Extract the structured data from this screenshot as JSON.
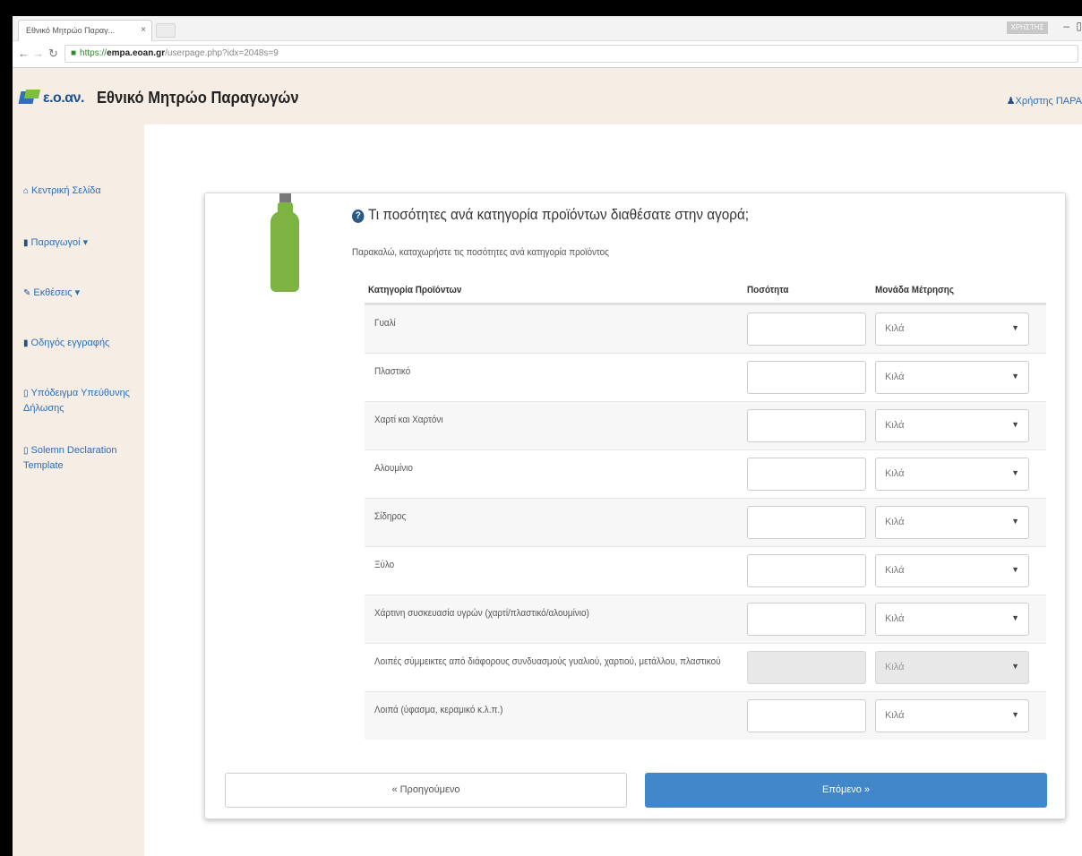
{
  "browser": {
    "tab_title": "Εθνικό Μητρώο Παραγ...",
    "tab_close": "×",
    "url_scheme": "https://",
    "url_host": "empa.eoan.gr",
    "url_path": "/userpage.php?idx=2048s=9",
    "window_user": "ΧΡΗΣΤΗΣ",
    "minimize": "–"
  },
  "header": {
    "logo_text": "ε.ο.αν.",
    "title": "Εθνικό Μητρώο Παραγωγών",
    "user_link": "Χρήστης ΠΑΡΑ"
  },
  "sidebar": {
    "items": [
      {
        "icon": "home-icon",
        "label": "Κεντρική Σελίδα"
      },
      {
        "icon": "book-icon",
        "label": "Παραγωγοί ▾"
      },
      {
        "icon": "pencil-icon",
        "label": "Εκθέσεις ▾"
      },
      {
        "icon": "book-icon",
        "label": "Οδηγός εγγραφής"
      },
      {
        "icon": "document-icon",
        "label": "Υπόδειγμα Υπεύθυνης Δήλωσης"
      },
      {
        "icon": "document-icon",
        "label": "Solemn Declaration Template"
      }
    ]
  },
  "form": {
    "question": "Τι ποσότητες ανά κατηγορία προϊόντων διαθέσατε στην αγορά;",
    "instruction": "Παρακαλώ, καταχωρήστε τις ποσότητες ανά κατηγορία προϊόντος",
    "columns": {
      "category": "Κατηγορία Προϊόντων",
      "quantity": "Ποσότητα",
      "unit": "Μονάδα Μέτρησης"
    },
    "rows": [
      {
        "category": "Γυαλί",
        "unit": "Κιλά"
      },
      {
        "category": "Πλαστικό",
        "unit": "Κιλά"
      },
      {
        "category": "Χαρτί και Χαρτόνι",
        "unit": "Κιλά"
      },
      {
        "category": "Αλουμίνιο",
        "unit": "Κιλά"
      },
      {
        "category": "Σίδηρος",
        "unit": "Κιλά"
      },
      {
        "category": "Ξύλο",
        "unit": "Κιλά"
      },
      {
        "category": "Χάρτινη συσκευασία υγρών (χαρτί/πλαστικό/αλουμίνιο)",
        "unit": "Κιλά"
      },
      {
        "category": "Λοιπές σύμμεικτες από διάφορους συνδυασμούς γυαλιού, χαρτιού, μετάλλου, πλαστικού",
        "unit": "Κιλά",
        "disabled": true
      },
      {
        "category": "Λοιπά (ύφασμα, κεραμικό κ.λ.π.)",
        "unit": "Κιλά"
      }
    ],
    "prev_label": "« Προηγούμενο",
    "next_label": "Επόμενο »"
  }
}
